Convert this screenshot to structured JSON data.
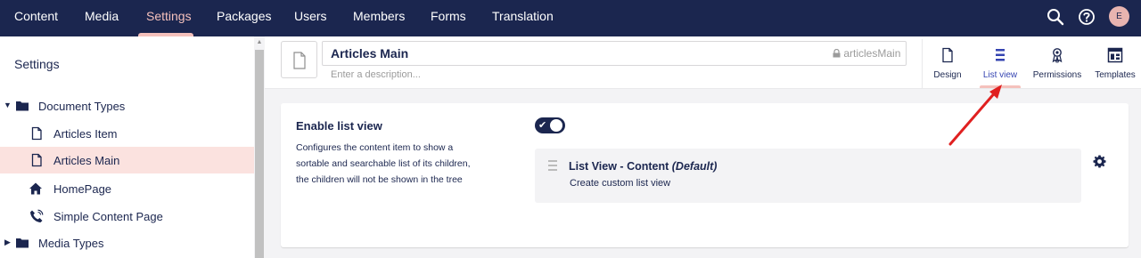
{
  "topnav": {
    "items": [
      "Content",
      "Media",
      "Settings",
      "Packages",
      "Users",
      "Members",
      "Forms",
      "Translation"
    ],
    "active": "Settings",
    "avatar_initial": "E",
    "icons": [
      "search-icon",
      "help-icon"
    ]
  },
  "sidebar": {
    "title": "Settings",
    "tree": [
      {
        "label": "Document Types",
        "icon": "folder-icon",
        "expanded": true
      },
      {
        "label": "Articles Item",
        "icon": "document-icon"
      },
      {
        "label": "Articles Main",
        "icon": "document-icon",
        "selected": true
      },
      {
        "label": "HomePage",
        "icon": "home-icon"
      },
      {
        "label": "Simple Content Page",
        "icon": "phone-icon"
      },
      {
        "label": "Media Types",
        "icon": "folder-icon",
        "expanded": false
      }
    ]
  },
  "editor": {
    "name": "Articles Main",
    "alias": "articlesMain",
    "description_placeholder": "Enter a description...",
    "apps": [
      {
        "label": "Design",
        "icon": "design-icon"
      },
      {
        "label": "List view",
        "icon": "list-icon",
        "active": true
      },
      {
        "label": "Permissions",
        "icon": "permissions-icon"
      },
      {
        "label": "Templates",
        "icon": "templates-icon"
      }
    ]
  },
  "property": {
    "label": "Enable list view",
    "description_lines": [
      "Configures the content item to show a",
      "sortable and searchable list of its children,",
      "the children will not be shown in the tree"
    ],
    "enabled": true,
    "listview_name": "List View - Content",
    "listview_default": "(Default)",
    "listview_action": "Create custom list view"
  },
  "colors": {
    "nav_bg": "#1b264f",
    "accent": "#f5c1bc",
    "selected_bg": "#fbe2df",
    "annotation": "#e02020"
  }
}
